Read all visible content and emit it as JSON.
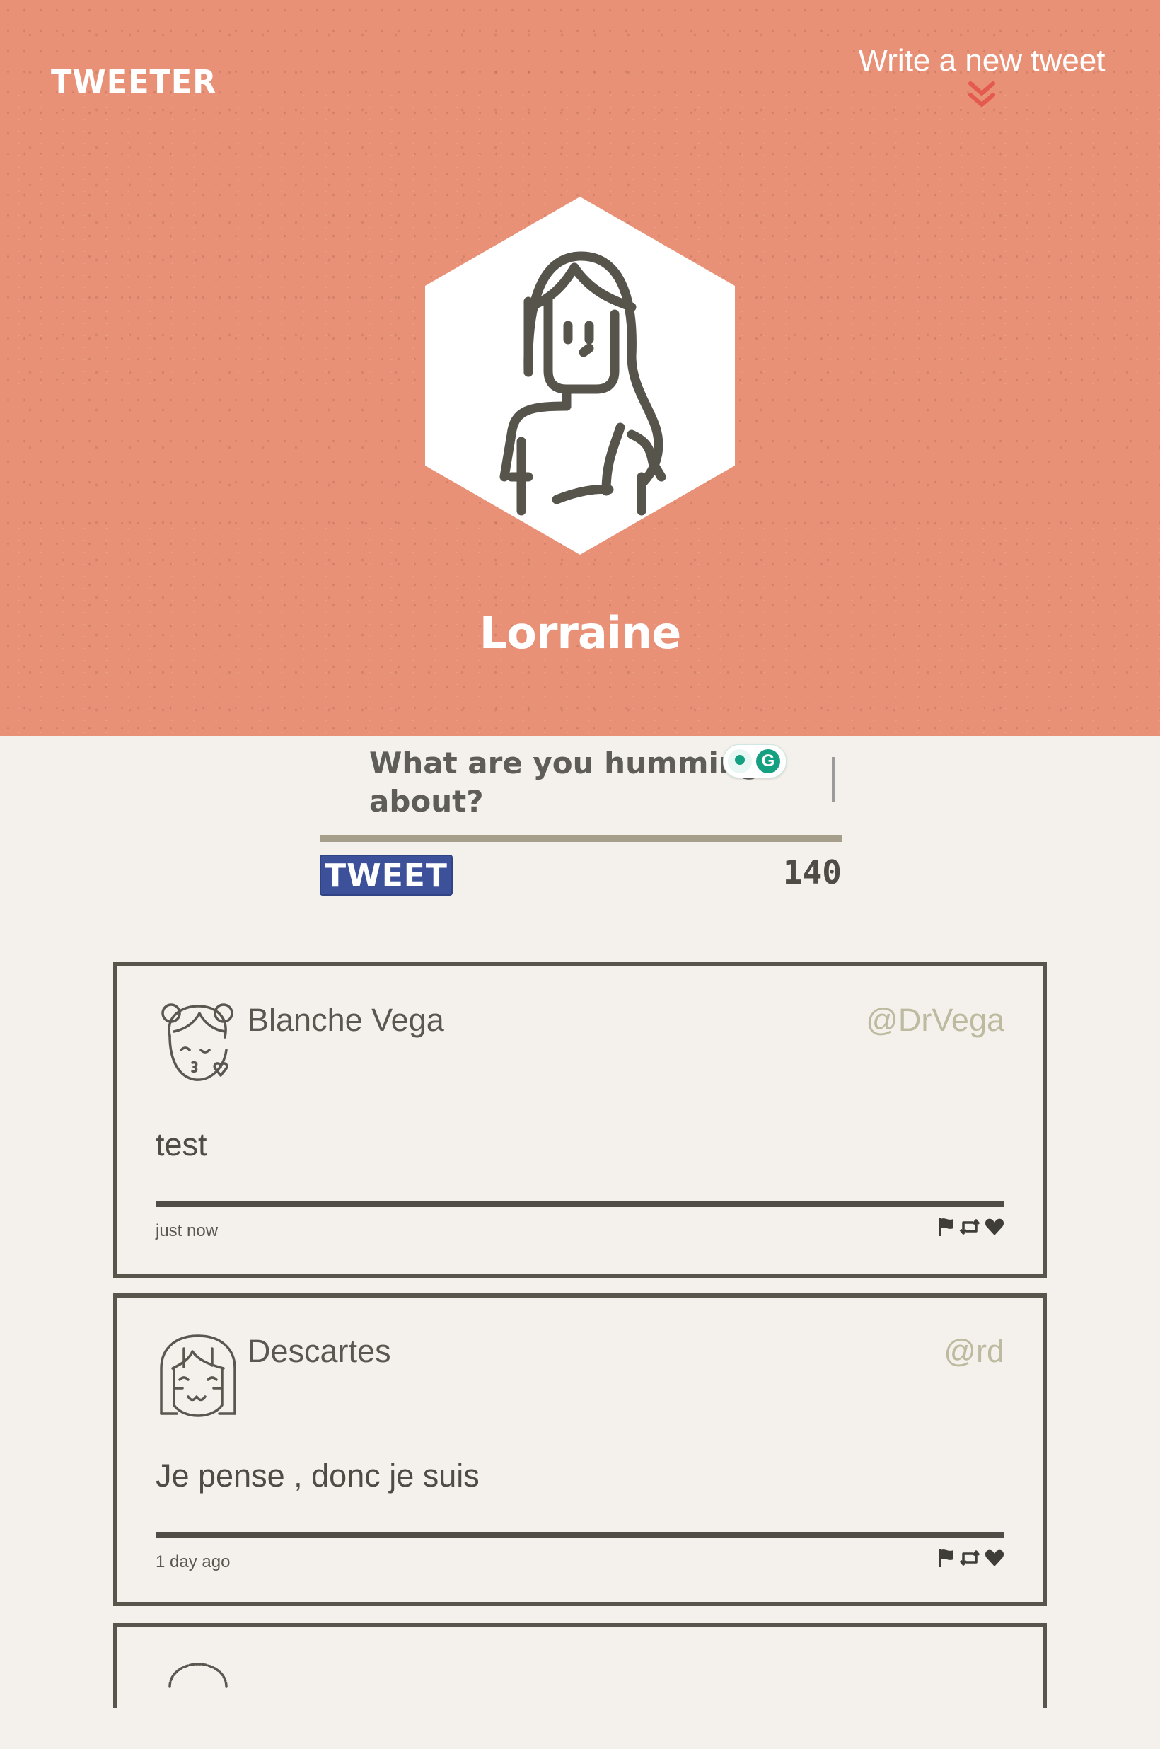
{
  "header": {
    "logo_text": "TWEETER",
    "compose_link": "Write a new tweet"
  },
  "profile": {
    "name": "Lorraine"
  },
  "composer": {
    "placeholder": "What are you humming about?",
    "submit_label": "TWEET",
    "char_count": "140"
  },
  "tweets": [
    {
      "name": "Blanche Vega",
      "handle": "@DrVega",
      "content": "test",
      "time": "just now",
      "avatar": "girl-kiss-avatar"
    },
    {
      "name": "Descartes",
      "handle": "@rd",
      "content": "Je pense , donc je suis",
      "time": "1 day ago",
      "avatar": "girl-bangs-avatar"
    }
  ],
  "colors": {
    "hero_bg": "#e99177",
    "page_bg": "#f4f1ec",
    "accent_button": "#3c519a",
    "text_dark": "#545149",
    "handle": "#bcbb9f",
    "chevron": "#e45a4f"
  },
  "icons": {
    "compose_chevron": "chevron-double-down-icon",
    "report": "flag-icon",
    "retweet": "retweet-icon",
    "like": "heart-icon"
  }
}
